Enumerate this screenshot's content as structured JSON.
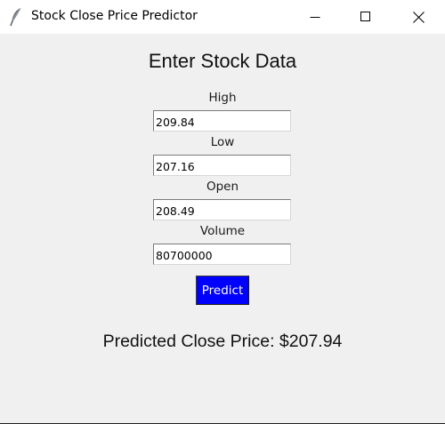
{
  "window": {
    "title": "Stock Close Price Predictor",
    "icon": "feather-icon",
    "controls": [
      "minimize-icon",
      "maximize-icon",
      "close-icon"
    ]
  },
  "form": {
    "heading": "Enter Stock Data",
    "fields": [
      {
        "label": "High",
        "value": "209.84"
      },
      {
        "label": "Low",
        "value": "207.16"
      },
      {
        "label": "Open",
        "value": "208.49"
      },
      {
        "label": "Volume",
        "value": "80700000"
      }
    ],
    "predict_label": "Predict"
  },
  "result": {
    "text": "Predicted Close Price: $207.94"
  },
  "colors": {
    "background": "#f0f0f0",
    "titlebar": "#ffffff",
    "button": "#0000ff",
    "button_text": "#ffffff"
  }
}
